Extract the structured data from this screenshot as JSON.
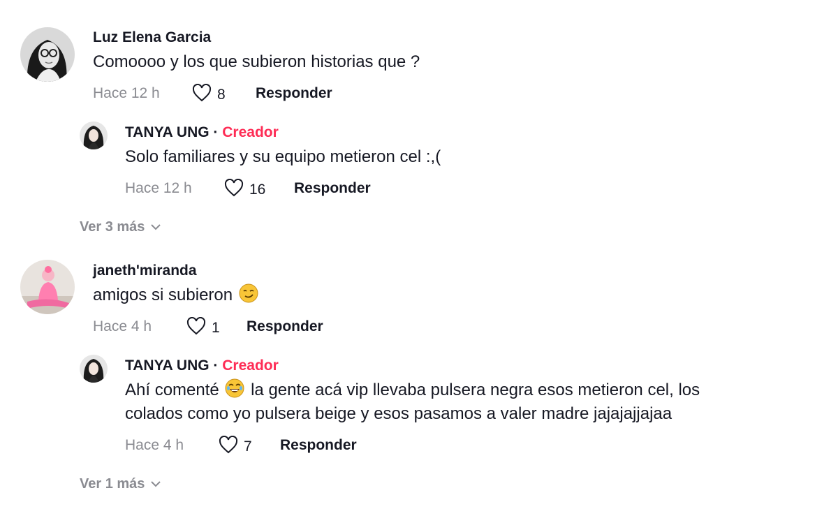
{
  "comments": [
    {
      "author": "Luz Elena Garcia",
      "text": "Comoooo y los que subieron historias que ?",
      "time": "Hace 12 h",
      "likes": "8",
      "reply_label": "Responder",
      "replies": [
        {
          "author": "TANYA UNG",
          "separator": "·",
          "badge": "Creador",
          "text": "Solo familiares y su equipo metieron cel :,(",
          "time": "Hace 12 h",
          "likes": "16",
          "reply_label": "Responder"
        }
      ],
      "more_label": "Ver 3 más"
    },
    {
      "author": "janeth'miranda",
      "text": "amigos si subieron",
      "emoji": "smirk-emoji",
      "time": "Hace 4 h",
      "likes": "1",
      "reply_label": "Responder",
      "replies": [
        {
          "author": "TANYA UNG",
          "separator": "·",
          "badge": "Creador",
          "text_before_emoji": "Ahí comenté",
          "emoji": "laughing-emoji",
          "text_after_emoji": "la gente acá vip llevaba pulsera negra esos metieron cel, los",
          "text_line2": "colados como yo pulsera beige y esos pasamos a valer madre jajajajjajaa",
          "time": "Hace 4 h",
          "likes": "7",
          "reply_label": "Responder"
        }
      ],
      "more_label": "Ver 1 más"
    }
  ],
  "colors": {
    "text": "#161823",
    "muted": "#8a8b91",
    "creator": "#fe2c55"
  }
}
